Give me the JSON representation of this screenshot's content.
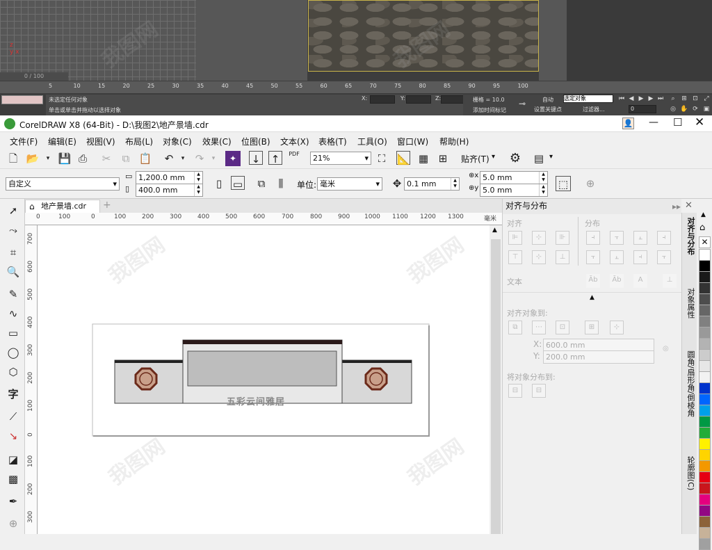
{
  "max": {
    "timeline": "0 / 100",
    "ticks": [
      "5",
      "10",
      "15",
      "20",
      "25",
      "30",
      "35",
      "40",
      "45",
      "50",
      "55",
      "60",
      "65",
      "70",
      "75",
      "80",
      "85",
      "90",
      "95",
      "100"
    ],
    "status1": "未选定任何对象",
    "status2": "单击或单击并拖动以选择对象",
    "coord_x": "X:",
    "coord_y": "Y:",
    "coord_z": "Z:",
    "grid": "栅格 = 10.0",
    "add_time": "添加时间标记",
    "auto": "自动",
    "selected": "选定对象",
    "set_key": "设置关键点",
    "filter": "过滤器...",
    "frame": "0"
  },
  "app": {
    "title": "CorelDRAW X8 (64-Bit) - D:\\我图2\\地产景墙.cdr"
  },
  "menu": [
    "文件(F)",
    "编辑(E)",
    "视图(V)",
    "布局(L)",
    "对象(C)",
    "效果(C)",
    "位图(B)",
    "文本(X)",
    "表格(T)",
    "工具(O)",
    "窗口(W)",
    "帮助(H)"
  ],
  "toolbar": {
    "zoom": "21%",
    "snap": "贴齐(T)",
    "pdf": "PDF"
  },
  "propbar": {
    "page_size": "自定义",
    "width": "1,200.0 mm",
    "height": "400.0 mm",
    "unit_label": "单位:",
    "unit": "毫米",
    "nudge": "0.1 mm",
    "dup_x": "5.0 mm",
    "dup_y": "5.0 mm"
  },
  "tab": {
    "name": "地产景墙.cdr"
  },
  "ruler": {
    "h": [
      "0",
      "100",
      "0",
      "100",
      "200",
      "300",
      "400",
      "500",
      "600",
      "700",
      "800",
      "900",
      "1000",
      "1100",
      "1200",
      "1300"
    ],
    "unit": "毫米",
    "v": [
      "700",
      "600",
      "500",
      "400",
      "300",
      "200",
      "100",
      "0",
      "100",
      "200",
      "300"
    ]
  },
  "drawing": {
    "text": "五彩云间雅居"
  },
  "docker": {
    "title": "对齐与分布",
    "align": "对齐",
    "distribute": "分布",
    "text": "文本",
    "align_to": "对齐对象到:",
    "x_label": "X:",
    "x_value": "600.0 mm",
    "y_label": "Y:",
    "y_value": "200.0 mm",
    "distribute_to": "将对象分布到:"
  },
  "vtabs": [
    "对齐与分布",
    "对象属性",
    "圆角/扇形角/倒棱角",
    "轮廓图(C)"
  ],
  "palette": [
    "#ffffff",
    "#000000",
    "#1a1a1a",
    "#333333",
    "#4d4d4d",
    "#666666",
    "#808080",
    "#999999",
    "#b3b3b3",
    "#cccccc",
    "#e6e6e6",
    "#f2f2f2",
    "#0033cc",
    "#0066ff",
    "#00a0e9",
    "#009944",
    "#22ac38",
    "#fff100",
    "#ffd400",
    "#f39800",
    "#e60012",
    "#c9161d",
    "#e4007f",
    "#920783",
    "#8c6239",
    "#c7b299",
    "#a0a0a0"
  ]
}
